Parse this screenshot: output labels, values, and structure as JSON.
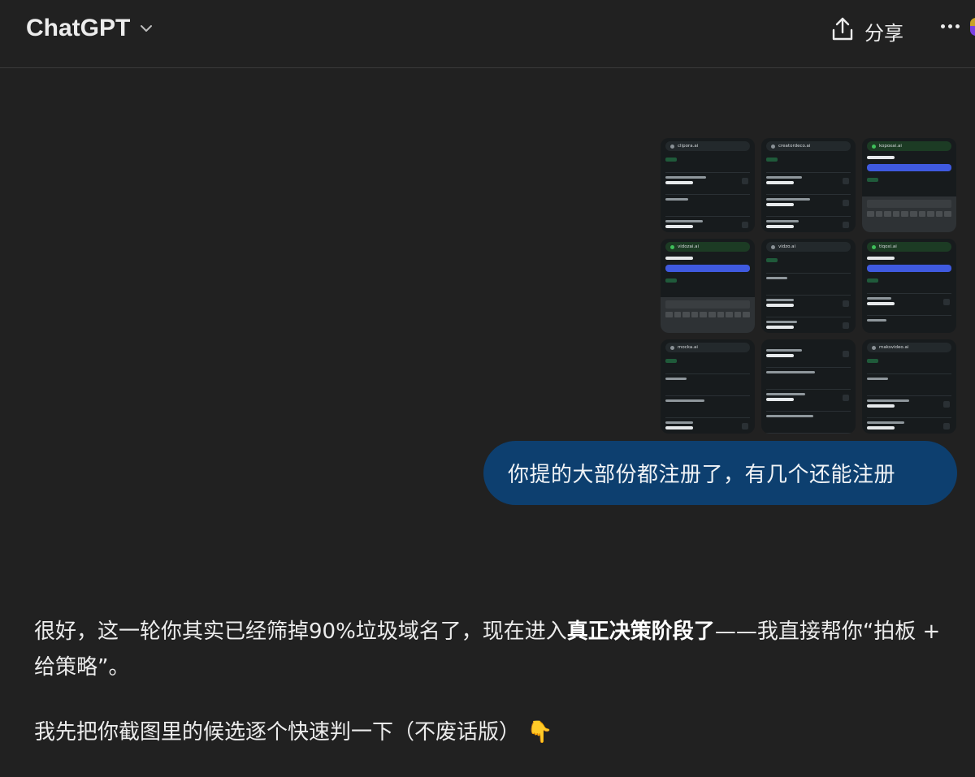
{
  "header": {
    "title": "ChatGPT",
    "share_label": "分享"
  },
  "thumbnails": [
    {
      "url": "clipora.ai"
    },
    {
      "url": "creatordeco.ai"
    },
    {
      "url": "kopoxai.ai"
    },
    {
      "url": "vidozai.ai"
    },
    {
      "url": "vidzo.ai"
    },
    {
      "url": "tiqoxi.ai"
    },
    {
      "url": "mocka.ai"
    },
    {
      "url": ""
    },
    {
      "url": "maksvideo.ai"
    }
  ],
  "user_message": "你提的大部份都注册了，有几个还能注册",
  "assistant": {
    "p1_part1": "很好，这一轮你其实已经筛掉90%垃圾域名了，现在进入",
    "p1_bold": "真正决策阶段了",
    "p1_part2": "——我直接帮你“拍板 + 给策略”。",
    "p2_text": "我先把你截图里的候选逐个快速判一下（不废话版）",
    "p2_emoji": "👇"
  }
}
